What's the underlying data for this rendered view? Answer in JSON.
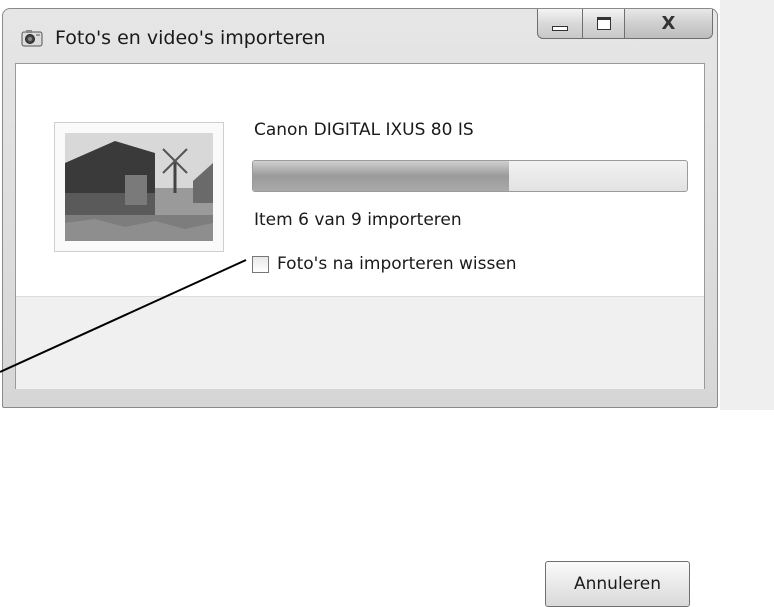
{
  "window": {
    "title": "Foto's en video's importeren",
    "controls": {
      "minimize_icon": "minimize-icon",
      "maximize_icon": "maximize-icon",
      "close_label": "X"
    }
  },
  "import": {
    "device_name": "Canon DIGITAL IXUS 80 IS",
    "progress": 0.59,
    "status": "Item 6 van 9 importeren",
    "delete_after_import": {
      "label": "Foto's na importeren wissen",
      "checked": false
    },
    "thumbnail": "windmill-photo"
  },
  "buttons": {
    "cancel": "Annuleren"
  },
  "colors": {
    "progress_fill": "#a0a0a0",
    "footer_bg": "#f0f0f0"
  }
}
